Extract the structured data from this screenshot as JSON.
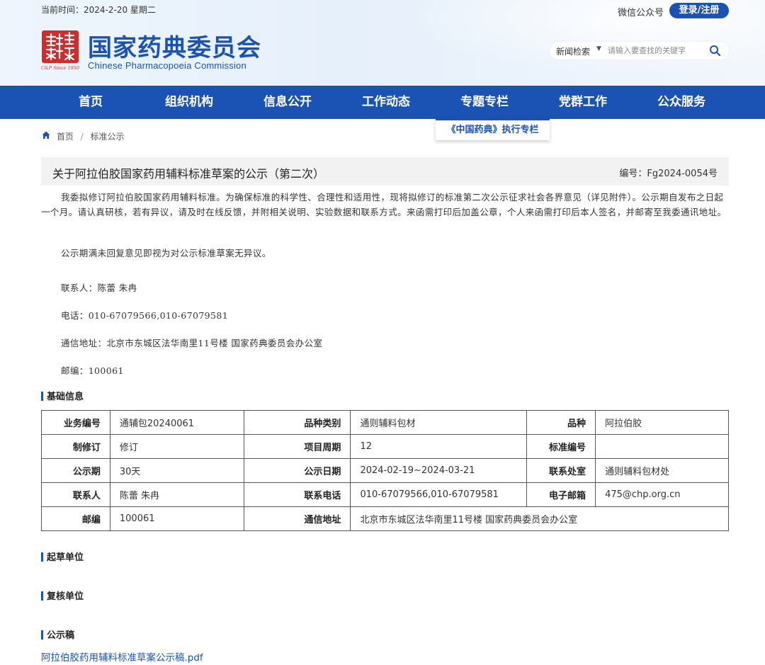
{
  "header": {
    "date_label": "当前时间：2024-2-20 星期二",
    "wechat": "微信公众号",
    "login": "登录/注册",
    "site_name": "国家药典委员会",
    "site_name_en": "Chinese Pharmacopoeia Commission",
    "seal_text": "C&P Since 1950"
  },
  "search": {
    "category": "新闻检索",
    "placeholder": "请输入要查找的关键字"
  },
  "nav": {
    "items": [
      "首页",
      "组织机构",
      "信息公开",
      "工作动态",
      "专题专栏",
      "党群工作",
      "公众服务"
    ],
    "dropdown": "《中国药典》执行专栏"
  },
  "breadcrumb": {
    "home": "首页",
    "current": "标准公示"
  },
  "article": {
    "title": "关于阿拉伯胶国家药用辅料标准草案的公示（第二次）",
    "number": "编号：Fg2024-0054号",
    "p1": "我委拟修订阿拉伯胶国家药用辅料标准。为确保标准的科学性、合理性和适用性，现将拟修订的标准第二次公示征求社会各界意见（详见附件）。公示期自发布之日起一个月。请认真研核，若有异议，请及时在线反馈，并附相关说明、实验数据和联系方式。来函需打印后加盖公章，个人来函需打印后本人签名，并邮寄至我委通讯地址。",
    "p2": "公示期满未回复意见即视为对公示标准草案无异议。",
    "contact": "联系人：陈蕾 朱冉",
    "phone": "电话：010-67079566,010-67079581",
    "address": "通信地址：北京市东城区法华南里11号楼 国家药典委员会办公室",
    "postcode": "邮编：100061"
  },
  "sections": {
    "basic": "基础信息",
    "drafter": "起草单位",
    "reviewer": "复核单位",
    "draft": "公示稿"
  },
  "table": {
    "r1": {
      "k1": "业务编号",
      "v1": "通辅包20240061",
      "k2": "品种类别",
      "v2": "通则辅料包材",
      "k3": "品种",
      "v3": "阿拉伯胶"
    },
    "r2": {
      "k1": "制修订",
      "v1": "修订",
      "k2": "项目周期",
      "v2": "12",
      "k3": "标准编号",
      "v3": ""
    },
    "r3": {
      "k1": "公示期",
      "v1": "30天",
      "k2": "公示日期",
      "v2": "2024-02-19~2024-03-21",
      "k3": "联系处室",
      "v3": "通则辅料包材处"
    },
    "r4": {
      "k1": "联系人",
      "v1": "陈蕾 朱冉",
      "k2": "联系电话",
      "v2": "010-67079566,010-67079581",
      "k3": "电子邮箱",
      "v3": "475@chp.org.cn"
    },
    "r5": {
      "k1": "邮编",
      "v1": "100061",
      "k2": "通信地址",
      "v2": "北京市东城区法华南里11号楼 国家药典委员会办公室"
    }
  },
  "attachment": {
    "label": "阿拉伯胶药用辅料标准草案公示稿.pdf"
  },
  "colors": {
    "primary": "#1b53b5",
    "seal": "#d32a2a",
    "title_bg": "#f2f2f2"
  }
}
